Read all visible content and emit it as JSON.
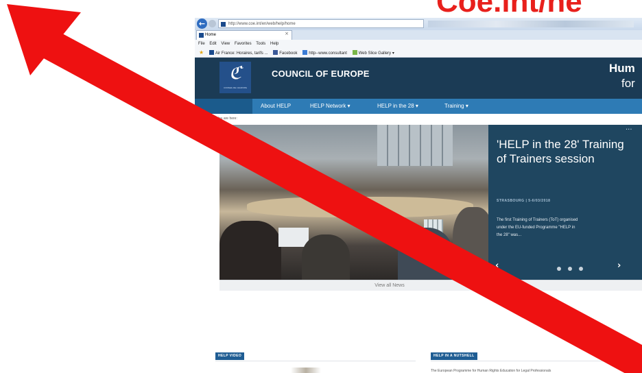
{
  "overlay_title": "Coe.int/he",
  "browser": {
    "address_url": "http://www.coe.int/en/web/help/home",
    "tab_label": "Home",
    "menu": [
      "File",
      "Edit",
      "View",
      "Favorites",
      "Tools",
      "Help"
    ],
    "favorites": [
      "Air France: Horaires, tarifs ...",
      "Facebook",
      "http--www.consultant",
      "Web Slice Gallery ▾"
    ]
  },
  "site": {
    "org_name": "COUNCIL OF EUROPE",
    "logo_text": "CONSEIL DE L'EUROPE",
    "tagline_line1": "Hum",
    "tagline_line2": "for",
    "nav": [
      {
        "label": "About HELP"
      },
      {
        "label": "HELP Network ▾"
      },
      {
        "label": "HELP in the 28 ▾"
      },
      {
        "label": "Training ▾"
      }
    ],
    "breadcrumb": "You are here:",
    "news": {
      "title": "'HELP in the 28' Training of Trainers session",
      "meta": "STRASBOURG | 5-6/03/2018",
      "body": "The first Training of Trainers (ToT) organised under the EU-funded Programme \"HELP in the 28\" was...",
      "more": "···"
    },
    "view_all": "View all News",
    "sections": {
      "video_badge": "HELP VIDEO",
      "nutshell_badge": "HELP IN A NUTSHELL",
      "nutshell_text": "The European Programme for Human Rights Education for Legal Professionals"
    }
  },
  "colors": {
    "accent_red": "#e8201c",
    "header_navy": "#1b3b55",
    "nav_blue": "#2e7bb5",
    "news_panel": "#1f4660"
  },
  "icons": [
    "back-arrow-icon",
    "favorites-star-icon",
    "tab-close-icon",
    "chevron-left-icon",
    "chevron-right-icon",
    "big-red-arrow-icon"
  ]
}
